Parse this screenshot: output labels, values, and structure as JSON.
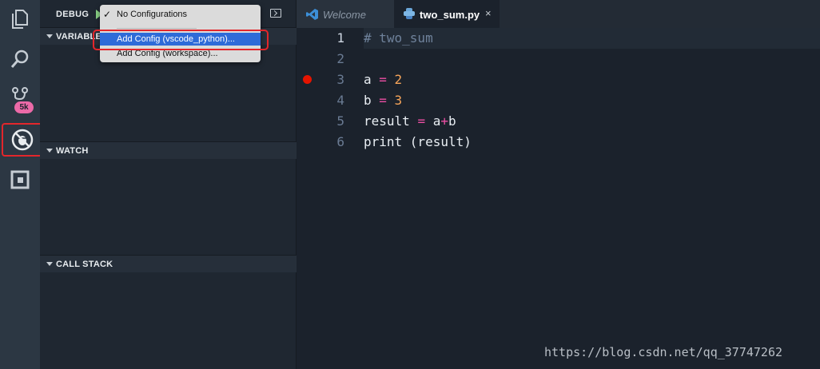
{
  "activity_bar": {
    "items": [
      "explorer-icon",
      "search-icon",
      "source-control-icon",
      "debug-icon",
      "extensions-icon"
    ],
    "badge": "5k",
    "badge_color": "#ec6aa8",
    "active_item": "debug-icon"
  },
  "sidebar": {
    "title": "DEBUG",
    "sections": {
      "variables": "VARIABLES",
      "watch": "WATCH",
      "call_stack": "CALL STACK"
    }
  },
  "dropdown": {
    "items": [
      {
        "label": "No Configurations",
        "checked": true
      },
      {
        "label": "Add Config (vscode_python)...",
        "selected": true
      },
      {
        "label": "Add Config (workspace)..."
      }
    ]
  },
  "tabs": [
    {
      "label": "Welcome",
      "icon": "vscode-icon",
      "active": false
    },
    {
      "label": "two_sum.py",
      "icon": "python-icon",
      "active": true,
      "close": "×"
    }
  ],
  "editor": {
    "line_numbers": [
      "1",
      "2",
      "3",
      "4",
      "5",
      "6"
    ],
    "breakpoint_line": 3,
    "breakpoint_color": "#e51400",
    "lines": [
      {
        "comment": "# two_sum"
      },
      {},
      {
        "var": "a ",
        "op": "=",
        "num": " 2"
      },
      {
        "var": "b ",
        "op": "=",
        "num": " 3"
      },
      {
        "lhs": "result ",
        "op": "=",
        "rhs_a": " a",
        "plus": "+",
        "rhs_b": "b"
      },
      {
        "text": "print (result)"
      }
    ]
  },
  "colors": {
    "highlight_box": "#e3262b",
    "selection": "#2e6bd8",
    "accent_pink": "#ec4fa4",
    "number_orange": "#f7a55a"
  },
  "watermark": "https://blog.csdn.net/qq_37747262"
}
